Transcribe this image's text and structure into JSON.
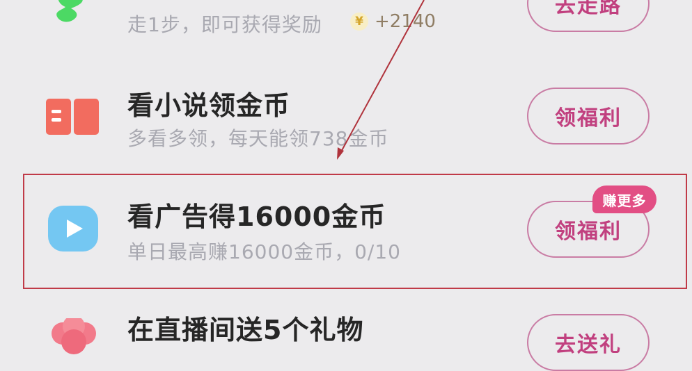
{
  "tasks": [
    {
      "title": "",
      "subtitle": "走1步，即可获得奖励",
      "reward": "+2140",
      "coin_symbol": "¥",
      "button": "去走路",
      "icon": "walking-shoe-icon"
    },
    {
      "title": "看小说领金币",
      "subtitle": "多看多领，每天能领738金币",
      "button": "领福利",
      "icon": "book-icon"
    },
    {
      "title": "看广告得16000金币",
      "subtitle": "单日最高赚16000金币，0/10",
      "button": "领福利",
      "badge": "赚更多",
      "icon": "video-play-icon"
    },
    {
      "title": "在直播间送5个礼物",
      "subtitle": "",
      "button": "去送礼",
      "icon": "gift-flower-icon"
    }
  ],
  "colors": {
    "background": "#ecebed",
    "button_border": "#c97ca4",
    "button_text": "#c1407f",
    "badge_bg": "#e24e84",
    "highlight_box": "#c03a48",
    "annotation_arrow": "#b0333c"
  }
}
